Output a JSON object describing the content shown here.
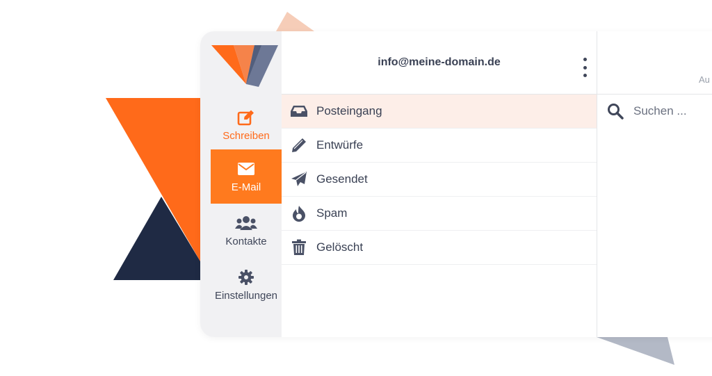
{
  "brand": {
    "accent": "#ff6a1a",
    "accent_active_bg": "#ff7a1e",
    "navy": "#1f2a44",
    "slate": "#6d7896"
  },
  "sidebar": {
    "items": [
      {
        "label": "Schreiben",
        "icon": "edit-icon"
      },
      {
        "label": "E-Mail",
        "icon": "envelope-icon",
        "active": true
      },
      {
        "label": "Kontakte",
        "icon": "users-icon"
      },
      {
        "label": "Einstellungen",
        "icon": "gear-icon"
      }
    ]
  },
  "account": {
    "email": "info@meine-domain.de",
    "menu_icon": "more-vertical-icon"
  },
  "folders": [
    {
      "label": "Posteingang",
      "icon": "inbox-icon",
      "active": true
    },
    {
      "label": "Entwürfe",
      "icon": "pencil-icon"
    },
    {
      "label": "Gesendet",
      "icon": "paper-plane-icon"
    },
    {
      "label": "Spam",
      "icon": "fire-icon"
    },
    {
      "label": "Gelöscht",
      "icon": "trash-icon"
    }
  ],
  "message_list": {
    "header_partial_text": "Au",
    "search": {
      "placeholder": "Suchen ...",
      "value": "",
      "icon": "search-icon"
    }
  }
}
